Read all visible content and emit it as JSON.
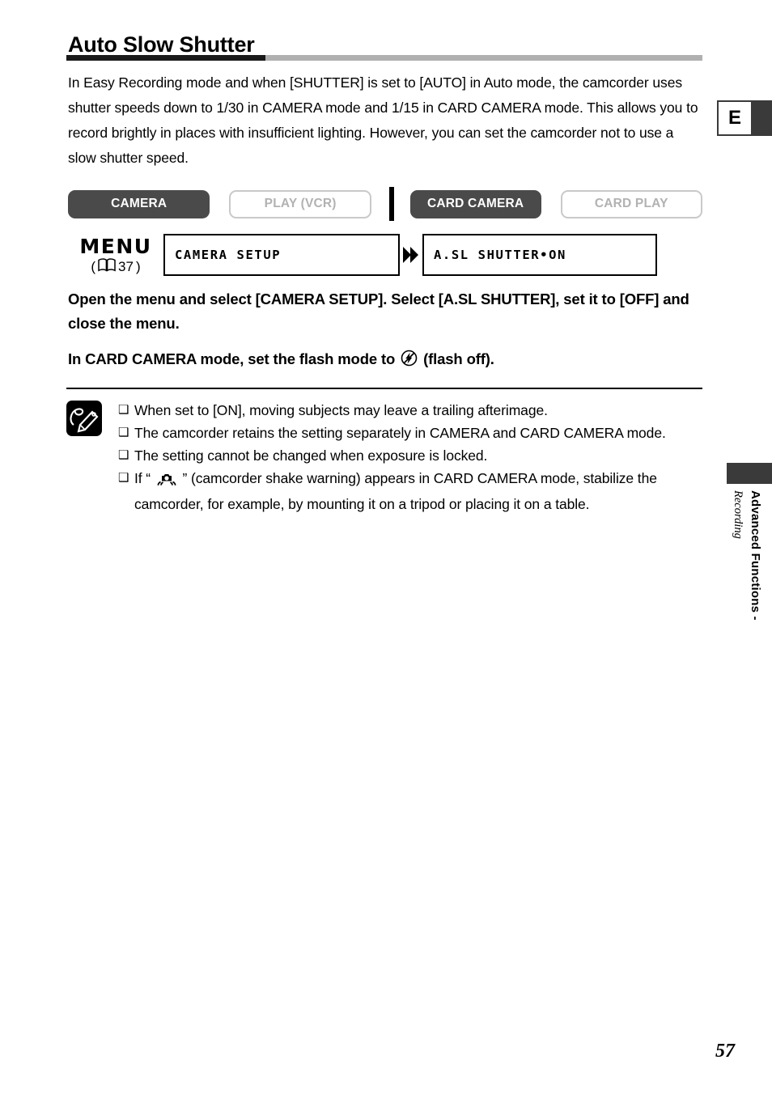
{
  "page": {
    "title": "Auto Slow Shutter",
    "number": "57",
    "language_tab": "E"
  },
  "intro": {
    "text": "In Easy Recording mode and when [SHUTTER] is set to [AUTO] in Auto mode, the camcorder uses shutter speeds down to 1/30 in CAMERA mode and 1/15 in CARD CAMERA mode. This allows you to record brightly in places with insufficient lighting. However, you can set the camcorder not to use a slow shutter speed."
  },
  "modes": [
    {
      "label": "CAMERA",
      "state": "active"
    },
    {
      "label": "PLAY (VCR)",
      "state": "inactive"
    },
    {
      "label": "CARD CAMERA",
      "state": "active"
    },
    {
      "label": "CARD PLAY",
      "state": "inactive"
    }
  ],
  "menu": {
    "label": "MENU",
    "reference_open": "(",
    "reference_page": "37",
    "reference_close": ")",
    "boxes": [
      {
        "text": "CAMERA SETUP"
      },
      {
        "text": "A.SL SHUTTER•ON"
      }
    ]
  },
  "instructions": [
    "Open the menu and select [CAMERA SETUP]. Select [A.SL SHUTTER], set it to [OFF] and close the menu.",
    {
      "before": "In CARD CAMERA mode, set the flash mode to ",
      "icon": "flash-off-icon",
      "after": " (flash off)."
    }
  ],
  "notes": {
    "icon": "note-pencil-icon",
    "bullet": "❑",
    "items": [
      {
        "text": "When set to [ON], moving subjects may leave a trailing afterimage."
      },
      {
        "text": "The camcorder retains the setting separately in CAMERA and CARD CAMERA mode."
      },
      {
        "text": "The setting cannot be changed when exposure is locked."
      },
      {
        "before": "If “ ",
        "icon": "camera-shake-warning-icon",
        "after": " ” (camcorder shake warning) appears in CARD CAMERA mode, stabilize the camcorder, for example, by mounting it on a tripod or placing it on a table."
      }
    ]
  },
  "side_tab": {
    "title": "Advanced Functions -",
    "subtitle": "Recording"
  },
  "colors": {
    "active_button": "#4a4a4a",
    "inactive_border": "#c9c9c9",
    "inactive_text": "#b2b2b2",
    "title_rule": "#b0b0b0",
    "tab_dark": "#3a3a3a"
  }
}
